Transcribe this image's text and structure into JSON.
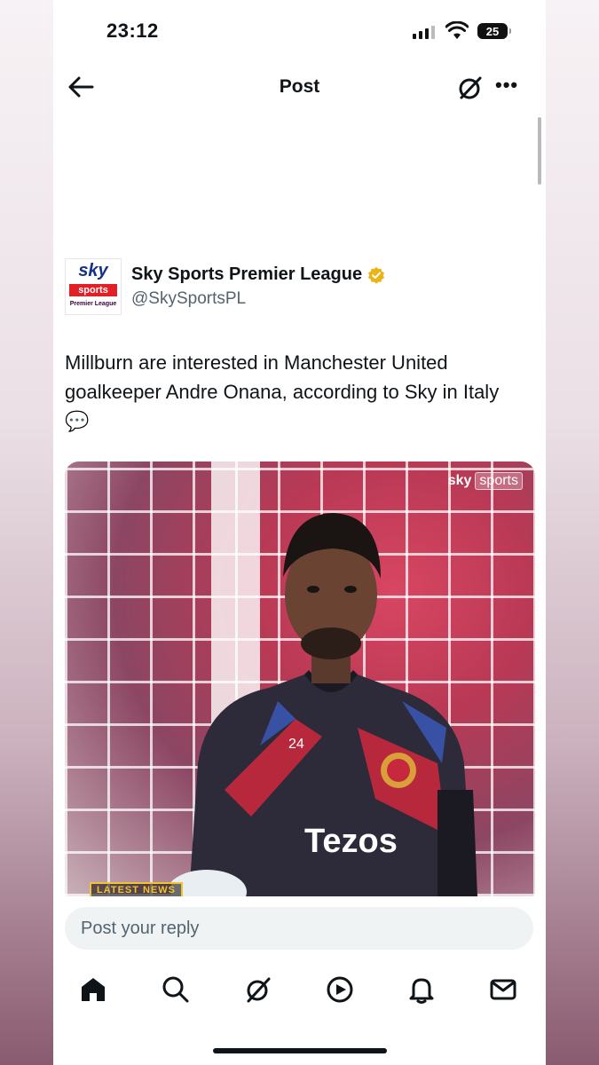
{
  "status_bar": {
    "time": "23:12",
    "battery": "25"
  },
  "nav": {
    "title": "Post"
  },
  "post": {
    "author_name": "Sky Sports Premier League",
    "handle": "@SkySportsPL",
    "avatar_text": {
      "sky": "sky",
      "sports": "sports",
      "league": "Premier League"
    },
    "text": "Millburn are interested in Manchester United goalkeeper Andre Onana, according to Sky in Italy 💬"
  },
  "media": {
    "sky_badge": {
      "sky": "sky",
      "sports": "sports"
    },
    "shirt_number": "24",
    "sponsor": "Tezos",
    "latest_news": "LATEST NEWS"
  },
  "reply": {
    "placeholder": "Post your reply"
  },
  "bottom_nav": {
    "items": [
      "home-icon",
      "search-icon",
      "grok-icon",
      "video-icon",
      "notifications-icon",
      "messages-icon"
    ]
  },
  "colors": {
    "verified": "#e8b416",
    "sky_red": "#e21e26",
    "sky_blue": "#15328a"
  }
}
